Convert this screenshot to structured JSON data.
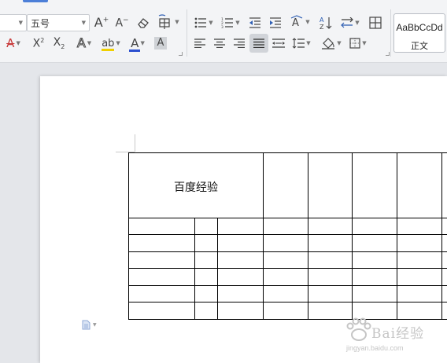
{
  "ribbon": {
    "font_size": {
      "value": "五号"
    },
    "font_family": {
      "value": ""
    },
    "styles": {
      "preview": "AaBbCcDd",
      "name": "正文"
    }
  },
  "document": {
    "table": {
      "merged_cell_text": "百度经验"
    }
  },
  "colors": {
    "accent": "#4c7fd8",
    "font_color": "#e03030",
    "highlight": "#f0d000",
    "underline_blue": "#2b4fcf"
  },
  "watermark": {
    "text": "Bai经验",
    "url": "jingyan.baidu.com"
  }
}
